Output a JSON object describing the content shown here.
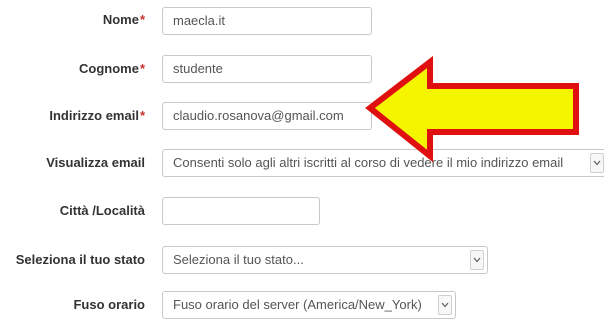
{
  "form": {
    "nome": {
      "label": "Nome",
      "required_mark": "*",
      "value": "maecla.it"
    },
    "cognome": {
      "label": "Cognome",
      "required_mark": "*",
      "value": "studente"
    },
    "email": {
      "label": "Indirizzo email",
      "required_mark": "*",
      "value": "claudio.rosanova@gmail.com"
    },
    "visualizza_email": {
      "label": "Visualizza email",
      "selected": "Consenti solo agli altri iscritti al corso di vedere il mio indirizzo email"
    },
    "citta": {
      "label": "Città /Località",
      "value": ""
    },
    "stato": {
      "label": "Seleziona il tuo stato",
      "selected": "Seleziona il tuo stato..."
    },
    "fuso_orario": {
      "label": "Fuso orario",
      "selected": "Fuso orario del server (America/New_York)"
    }
  },
  "annotation": {
    "arrow_color": "#f5f500",
    "arrow_border": "#e01010",
    "arrow_icon": "arrow-left-icon"
  }
}
